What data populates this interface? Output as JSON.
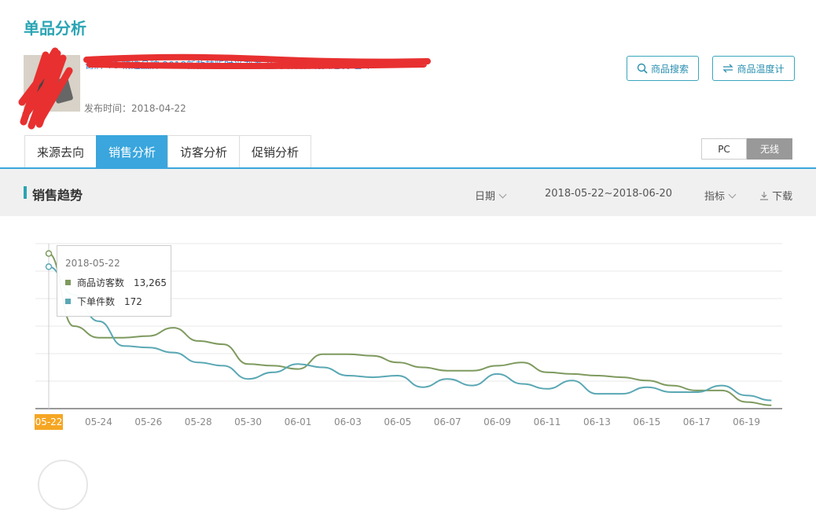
{
  "page": {
    "title": "单品分析"
  },
  "product": {
    "title": "奇牌 TC 精选品牌 2018新款韩版时尚潮流 全网最低价现货速发 包邮",
    "publish_label": "发布时间：2018-04-22"
  },
  "buttons": {
    "search": "商品搜索",
    "temperature": "商品温度计"
  },
  "tabs": [
    "来源去向",
    "销售分析",
    "访客分析",
    "促销分析"
  ],
  "active_tab": 1,
  "device_toggle": {
    "options": [
      "PC",
      "无线"
    ],
    "selected": "无线"
  },
  "section": {
    "title": "销售趋势",
    "date_dim": "日期",
    "date_range": "2018-05-22~2018-06-20",
    "metric": "指标",
    "download": "下载"
  },
  "tooltip": {
    "date": "2018-05-22",
    "rows": [
      {
        "name": "商品访客数",
        "value": "13,265",
        "color": "#7e9a5f"
      },
      {
        "name": "下单件数",
        "value": "172",
        "color": "#5aa8b4"
      }
    ]
  },
  "chart_data": {
    "type": "line",
    "x": [
      "05-22",
      "05-23",
      "05-24",
      "05-25",
      "05-26",
      "05-27",
      "05-28",
      "05-29",
      "05-30",
      "05-31",
      "06-01",
      "06-02",
      "06-03",
      "06-04",
      "06-05",
      "06-06",
      "06-07",
      "06-08",
      "06-09",
      "06-10",
      "06-11",
      "06-12",
      "06-13",
      "06-14",
      "06-15",
      "06-16",
      "06-17",
      "06-18",
      "06-19",
      "06-20"
    ],
    "tick_labels": [
      "05-22",
      "05-24",
      "05-26",
      "05-28",
      "05-30",
      "06-01",
      "06-03",
      "06-05",
      "06-07",
      "06-09",
      "06-11",
      "06-13",
      "06-15",
      "06-17",
      "06-19"
    ],
    "highlight_x": "05-22",
    "series": [
      {
        "name": "商品访客数",
        "color": "#7e9a5f",
        "values": [
          0.94,
          0.5,
          0.43,
          0.43,
          0.44,
          0.49,
          0.41,
          0.39,
          0.27,
          0.26,
          0.24,
          0.33,
          0.33,
          0.32,
          0.28,
          0.25,
          0.23,
          0.23,
          0.26,
          0.28,
          0.22,
          0.21,
          0.2,
          0.19,
          0.17,
          0.14,
          0.11,
          0.11,
          0.04,
          0.02
        ]
      },
      {
        "name": "下单件数",
        "color": "#5aa8b4",
        "values": [
          0.86,
          0.69,
          0.53,
          0.38,
          0.37,
          0.34,
          0.28,
          0.26,
          0.18,
          0.22,
          0.27,
          0.25,
          0.2,
          0.19,
          0.2,
          0.13,
          0.18,
          0.14,
          0.21,
          0.15,
          0.12,
          0.17,
          0.09,
          0.09,
          0.13,
          0.1,
          0.1,
          0.14,
          0.08,
          0.05
        ]
      }
    ],
    "grid": true,
    "legend": "none"
  }
}
